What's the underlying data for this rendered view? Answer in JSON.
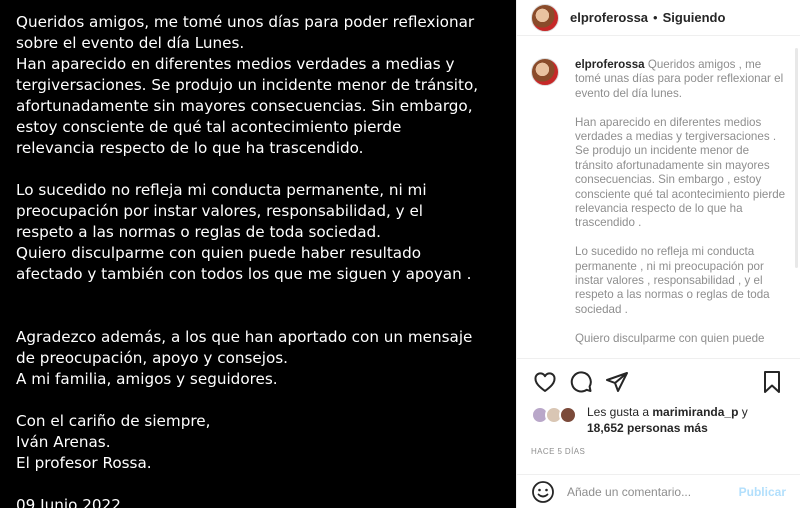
{
  "post_text_lines": [
    "Queridos amigos, me tomé unos días para poder reflexionar",
    "sobre el evento del día Lunes.",
    "Han aparecido en diferentes medios verdades a medias y",
    "tergiversaciones. Se produjo un incidente menor de tránsito,",
    "afortunadamente sin mayores consecuencias. Sin embargo,",
    "estoy consciente de qué tal acontecimiento pierde",
    "relevancia respecto de lo que ha trascendido.",
    "",
    "Lo sucedido no refleja mi conducta permanente, ni mi",
    "preocupación por instar valores, responsabilidad, y el",
    "respeto a las normas o reglas de toda sociedad.",
    "Quiero disculparme con quien puede haber resultado",
    "afectado y también con todos los que me siguen y apoyan .",
    "",
    "",
    "Agradezco además, a los que han aportado con un mensaje",
    "de preocupación, apoyo y consejos.",
    "A mi familia, amigos y seguidores.",
    "",
    "Con el cariño de siempre,",
    "Iván Arenas.",
    "El profesor Rossa.",
    "",
    "09 Junio 2022."
  ],
  "header": {
    "username": "elproferossa",
    "separator": "•",
    "follow_label": "Siguiendo"
  },
  "caption": {
    "username": "elproferossa",
    "paragraphs": [
      "Queridos amigos , me tomé unas días para poder reflexionar el evento del día lunes.",
      "Han aparecido en diferentes medios verdades a medias y tergiversaciones . Se produjo un incidente menor de tránsito afortunadamente sin mayores consecuencias. Sin embargo , estoy consciente qué tal acontecimiento pierde relevancia respecto de lo que ha trascendido .",
      "Lo sucedido no refleja mi conducta permanente , ni mi preocupación por instar valores , responsabilidad , y el respeto a las normas o reglas de toda sociedad .",
      "Quiero disculparme con quien puede"
    ]
  },
  "likes": {
    "prefix": "Les gusta a",
    "liker": "marimiranda_p",
    "connector": "y",
    "count": "18,652 personas más"
  },
  "timestamp": "HACE 5 DÍAS",
  "comment": {
    "placeholder": "Añade un comentario...",
    "post_label": "Publicar"
  },
  "icons": {
    "like": "heart-icon",
    "comment": "comment-icon",
    "share": "share-icon",
    "save": "bookmark-icon",
    "emoji": "emoji-icon"
  }
}
